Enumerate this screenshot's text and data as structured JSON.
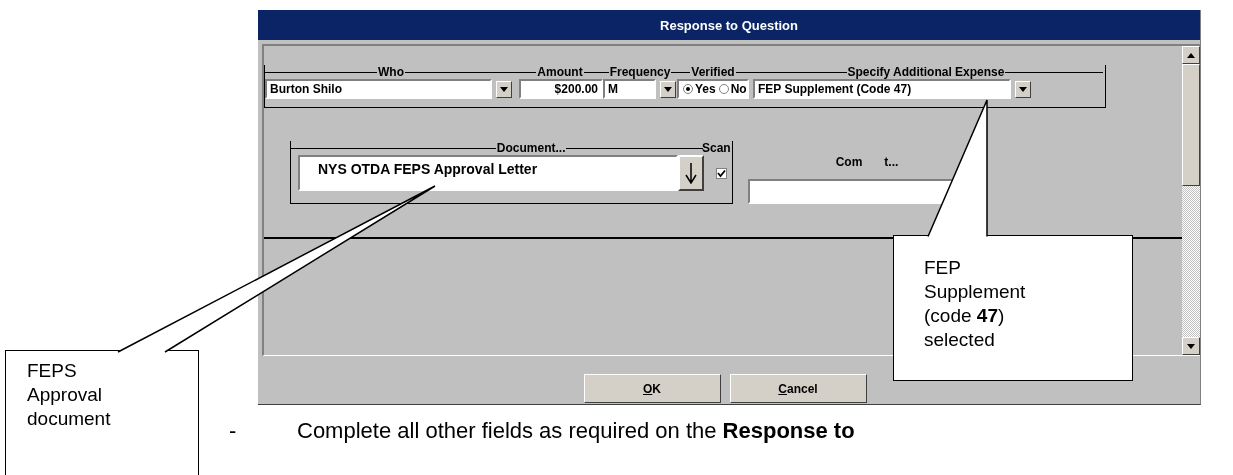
{
  "window": {
    "title": "Response to Question"
  },
  "expense_row": {
    "who": {
      "label": "Who",
      "value": "Burton Shilo"
    },
    "amount": {
      "label": "Amount",
      "value": "$200.00"
    },
    "frequency": {
      "label": "Frequency",
      "value": "M"
    },
    "verified": {
      "label": "Verified",
      "options": [
        {
          "label": "Yes",
          "selected": true
        },
        {
          "label": "No",
          "selected": false
        }
      ]
    },
    "additional_expense": {
      "label": "Specify Additional Expense",
      "value": "FEP Supplement (Code 47)"
    }
  },
  "document": {
    "label": "Document...",
    "value": "NYS OTDA FEPS Approval Letter",
    "scan_label": "Scan",
    "scan_checked": true
  },
  "comment": {
    "label_parts": [
      "Com",
      "t..."
    ]
  },
  "buttons": [
    {
      "label": "OK",
      "underlined_initial": true
    },
    {
      "label": "Cancel",
      "underlined_initial": true
    }
  ],
  "callouts": [
    {
      "text": "FEPS Approval document"
    },
    {
      "text": "FEP Supplement (code **47**) selected"
    }
  ],
  "note": {
    "bullet": "-",
    "text": "Complete all other fields as required on the **Response to**"
  }
}
